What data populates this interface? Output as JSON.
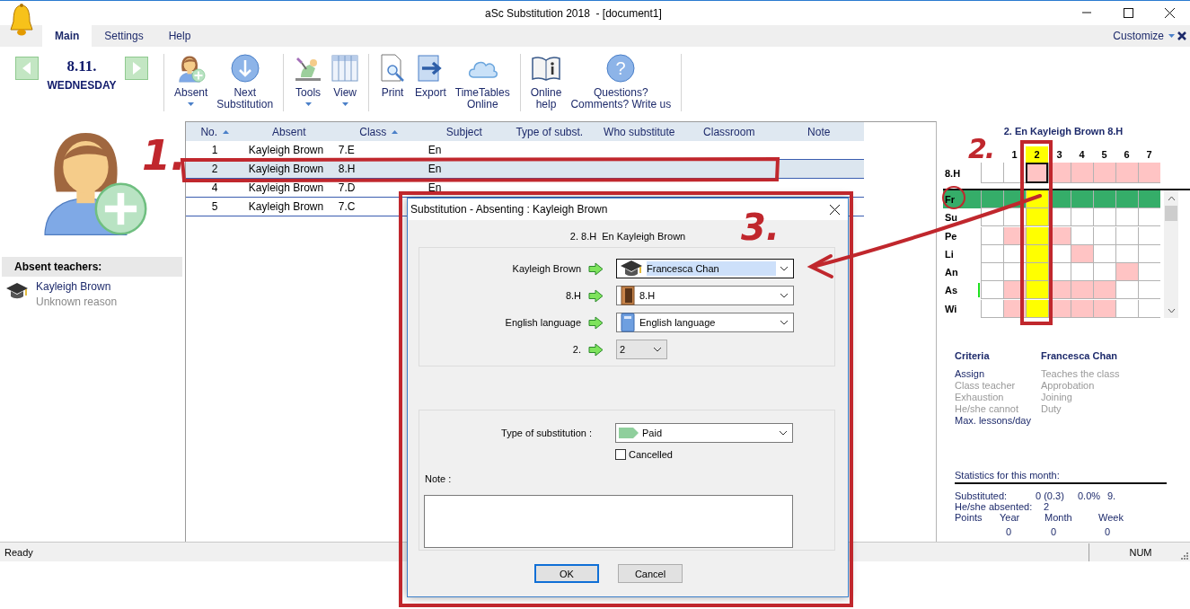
{
  "window": {
    "title": "aSc Substitution 2018  - [document1]"
  },
  "menu_tabs": [
    {
      "label": "Main",
      "selected": true
    },
    {
      "label": "Settings",
      "selected": false
    },
    {
      "label": "Help",
      "selected": false
    }
  ],
  "customize": {
    "label": "Customize"
  },
  "date": {
    "day": "8.11.",
    "weekday": "WEDNESDAY"
  },
  "toolbar": [
    [
      {
        "label": "Absent",
        "kind": "person",
        "dropdown": true
      },
      {
        "label": "Next\nSubstitution",
        "kind": "next",
        "dropdown": false
      }
    ],
    [
      {
        "label": "Tools",
        "kind": "tools",
        "dropdown": true
      },
      {
        "label": "View",
        "kind": "view",
        "dropdown": true
      }
    ],
    [
      {
        "label": "Print",
        "kind": "print",
        "dropdown": false
      },
      {
        "label": "Export",
        "kind": "export",
        "dropdown": false
      },
      {
        "label": "TimeTables\nOnline",
        "kind": "online",
        "dropdown": false
      }
    ],
    [
      {
        "label": "Online\nhelp",
        "kind": "help",
        "dropdown": false
      },
      {
        "label": "Questions?\nComments? Write us",
        "kind": "question",
        "glyph": "?",
        "dropdown": false
      }
    ]
  ],
  "absent_teachers": {
    "title": "Absent teachers:",
    "items": [
      {
        "name": "Kayleigh Brown",
        "reason": "Unknown reason"
      }
    ]
  },
  "table": {
    "columns": [
      {
        "label": "No.",
        "sorted": true
      },
      {
        "label": "Absent",
        "sorted": false
      },
      {
        "label": "Class",
        "sorted": true
      },
      {
        "label": "Subject",
        "sorted": false
      },
      {
        "label": "Type of subst.",
        "sorted": false
      },
      {
        "label": "Who substitute",
        "sorted": false
      },
      {
        "label": "Classroom",
        "sorted": false
      },
      {
        "label": "Note",
        "sorted": false
      }
    ],
    "rows": [
      {
        "cells": [
          "1",
          "Kayleigh Brown",
          "7.E",
          "En"
        ],
        "selected": false
      },
      {
        "cells": [
          "2",
          "Kayleigh Brown",
          "8.H",
          "En"
        ],
        "selected": true
      },
      {
        "cells": [
          "4",
          "Kayleigh Brown",
          "7.D",
          "En"
        ],
        "selected": false
      },
      {
        "cells": [
          "5",
          "Kayleigh Brown",
          "7.C"
        ],
        "selected": false
      }
    ]
  },
  "timetable": {
    "title": "2. En Kayleigh Brown 8.H",
    "periods": [
      {
        "label": "1",
        "selected": false
      },
      {
        "label": "2",
        "selected": true
      },
      {
        "label": "3",
        "selected": false
      },
      {
        "label": "4",
        "selected": false
      },
      {
        "label": "5",
        "selected": false
      },
      {
        "label": "6",
        "selected": false
      },
      {
        "label": "7",
        "selected": false
      }
    ],
    "class_row": {
      "label": "8.H",
      "selected": false,
      "marker": false,
      "cells": [
        {
          "kind": "free"
        },
        {
          "kind": "free"
        },
        {
          "kind": "current"
        },
        {
          "kind": "busy"
        },
        {
          "kind": "busy"
        },
        {
          "kind": "busy"
        },
        {
          "kind": "busy"
        },
        {
          "kind": "busy"
        }
      ]
    },
    "teachers": [
      {
        "label": "Fr",
        "selected": true,
        "marker": false,
        "cells": [
          {
            "kind": "selected"
          },
          {
            "kind": "selected"
          },
          {
            "kind": "highlight"
          },
          {
            "kind": "selected"
          },
          {
            "kind": "selected"
          },
          {
            "kind": "selected"
          },
          {
            "kind": "selected"
          },
          {
            "kind": "selected"
          }
        ]
      },
      {
        "label": "Su",
        "selected": false,
        "marker": false,
        "cells": [
          {
            "kind": "free"
          },
          {
            "kind": "free"
          },
          {
            "kind": "highlight"
          },
          {
            "kind": "free"
          },
          {
            "kind": "free"
          },
          {
            "kind": "free"
          },
          {
            "kind": "free"
          },
          {
            "kind": "free"
          }
        ]
      },
      {
        "label": "Pe",
        "selected": false,
        "marker": false,
        "cells": [
          {
            "kind": "free"
          },
          {
            "kind": "busy"
          },
          {
            "kind": "highlight"
          },
          {
            "kind": "busy"
          },
          {
            "kind": "free"
          },
          {
            "kind": "free"
          },
          {
            "kind": "free"
          },
          {
            "kind": "free"
          }
        ]
      },
      {
        "label": "Li",
        "selected": false,
        "marker": false,
        "cells": [
          {
            "kind": "free"
          },
          {
            "kind": "free"
          },
          {
            "kind": "highlight"
          },
          {
            "kind": "free"
          },
          {
            "kind": "busy"
          },
          {
            "kind": "free"
          },
          {
            "kind": "free"
          },
          {
            "kind": "free"
          }
        ]
      },
      {
        "label": "An",
        "selected": false,
        "marker": false,
        "cells": [
          {
            "kind": "free"
          },
          {
            "kind": "free"
          },
          {
            "kind": "highlight"
          },
          {
            "kind": "free"
          },
          {
            "kind": "free"
          },
          {
            "kind": "free"
          },
          {
            "kind": "busy"
          },
          {
            "kind": "free"
          }
        ]
      },
      {
        "label": "As",
        "selected": false,
        "marker": true,
        "cells": [
          {
            "kind": "free"
          },
          {
            "kind": "busy"
          },
          {
            "kind": "highlight"
          },
          {
            "kind": "busy"
          },
          {
            "kind": "busy"
          },
          {
            "kind": "busy"
          },
          {
            "kind": "free"
          },
          {
            "kind": "free"
          }
        ]
      },
      {
        "label": "Wi",
        "selected": false,
        "marker": false,
        "cells": [
          {
            "kind": "free"
          },
          {
            "kind": "busy"
          },
          {
            "kind": "highlight"
          },
          {
            "kind": "busy"
          },
          {
            "kind": "busy"
          },
          {
            "kind": "busy"
          },
          {
            "kind": "free"
          },
          {
            "kind": "free"
          }
        ]
      }
    ]
  },
  "criteria": {
    "title": "Criteria",
    "teacher": "Francesca Chan",
    "left": [
      {
        "label": "Assign",
        "active": true
      },
      {
        "label": "Class teacher",
        "active": false
      },
      {
        "label": "Exhaustion",
        "active": false
      },
      {
        "label": "He/she cannot",
        "active": false
      },
      {
        "label": "Max. lessons/day",
        "active": true
      }
    ],
    "right": [
      {
        "label": "Teaches the class",
        "active": false
      },
      {
        "label": "Approbation",
        "active": false
      },
      {
        "label": "Joining",
        "active": false
      },
      {
        "label": "Duty",
        "active": false
      }
    ]
  },
  "statistics": {
    "title": "Statistics for this month:",
    "substituted": {
      "label": "Substituted:",
      "values": [
        "0 (0.3)",
        "0.0%",
        "9."
      ]
    },
    "absented": {
      "label": "He/she absented:",
      "value": "2"
    },
    "points": {
      "label": "Points",
      "columns": [
        "Year",
        "Month",
        "Week"
      ],
      "values": [
        "0",
        "0",
        "0"
      ]
    }
  },
  "status_bar": {
    "text": "Ready",
    "indicator": "NUM"
  },
  "dialog": {
    "title": "Substitution - Absenting : Kayleigh Brown",
    "subtitle": "2. 8.H  En Kayleigh Brown",
    "fields": [
      {
        "label": "Kayleigh Brown",
        "kind": "teacher",
        "value": "Francesca Chan",
        "focused": true
      },
      {
        "label": "8.H",
        "kind": "class",
        "value": "8.H",
        "focused": false
      },
      {
        "label": "English language",
        "kind": "subject",
        "value": "English language",
        "focused": false
      },
      {
        "label": "2.",
        "kind": "period",
        "value": "2",
        "focused": false
      }
    ],
    "type": {
      "label": "Type of substitution :",
      "value": "Paid",
      "color": "#8fcf9c"
    },
    "cancelled": {
      "label": "Cancelled",
      "checked": false
    },
    "note": {
      "label": "Note :"
    },
    "buttons": [
      {
        "label": "OK",
        "default": true
      },
      {
        "label": "Cancel",
        "default": false
      }
    ]
  },
  "annotations": [
    {
      "text": "1."
    },
    {
      "text": "2."
    },
    {
      "text": "3."
    }
  ]
}
